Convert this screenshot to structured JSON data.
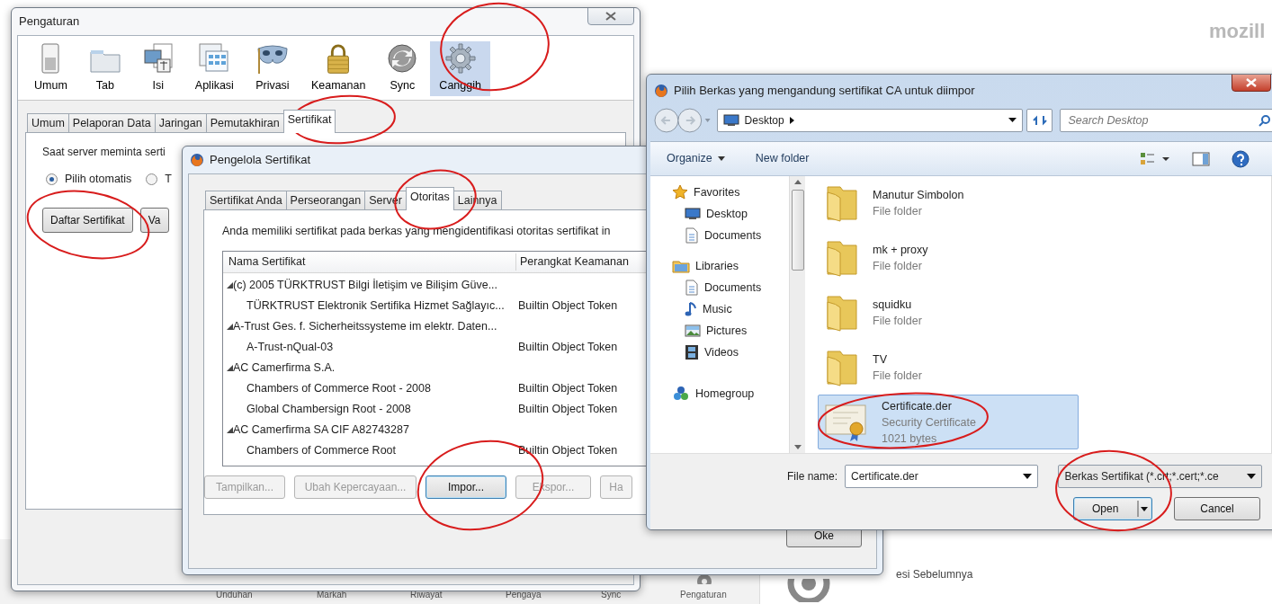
{
  "background": {
    "logo": "mozill",
    "toolbar": [
      "Unduhan",
      "Markah",
      "Riwayat",
      "Pengaya",
      "Sync",
      "Pengaturan"
    ],
    "restore": "esi Sebelumnya"
  },
  "settings_window": {
    "title": "Pengaturan",
    "categories": [
      {
        "label": "Umum",
        "selected": false
      },
      {
        "label": "Tab",
        "selected": false
      },
      {
        "label": "Isi",
        "selected": false
      },
      {
        "label": "Aplikasi",
        "selected": false
      },
      {
        "label": "Privasi",
        "selected": false
      },
      {
        "label": "Keamanan",
        "selected": false
      },
      {
        "label": "Sync",
        "selected": false
      },
      {
        "label": "Canggih",
        "selected": true
      }
    ],
    "subtabs": [
      {
        "label": "Umum",
        "selected": false
      },
      {
        "label": "Pelaporan Data",
        "selected": false
      },
      {
        "label": "Jaringan",
        "selected": false
      },
      {
        "label": "Pemutakhiran",
        "selected": false
      },
      {
        "label": "Sertifikat",
        "selected": true
      }
    ],
    "prompt": "Saat server meminta serti",
    "radios": [
      {
        "label": "Pilih otomatis",
        "selected": true
      },
      {
        "label": "T",
        "selected": false
      }
    ],
    "buttons": [
      "Daftar Sertifikat",
      "Va"
    ]
  },
  "cert_manager": {
    "title": "Pengelola Sertifikat",
    "tabs": [
      {
        "label": "Sertifikat Anda",
        "selected": false
      },
      {
        "label": "Perseorangan",
        "selected": false
      },
      {
        "label": "Server",
        "selected": false
      },
      {
        "label": "Otoritas",
        "selected": true
      },
      {
        "label": "Lainnya",
        "selected": false
      }
    ],
    "description": "Anda memiliki sertifikat pada berkas yang mengidentifikasi otoritas sertifikat in",
    "columns": [
      "Nama Sertifikat",
      "Perangkat Keamanan"
    ],
    "tree": [
      {
        "name": "(c) 2005 TÜRKTRUST Bilgi İletişim ve Bilişim Güve...",
        "expanded": true,
        "children": [
          {
            "name": "TÜRKTRUST Elektronik Sertifika Hizmet Sağlayıc...",
            "device": "Builtin Object Token"
          }
        ]
      },
      {
        "name": "A-Trust Ges. f. Sicherheitssysteme im elektr. Daten...",
        "expanded": true,
        "children": [
          {
            "name": "A-Trust-nQual-03",
            "device": "Builtin Object Token"
          }
        ]
      },
      {
        "name": "AC Camerfirma S.A.",
        "expanded": true,
        "children": [
          {
            "name": "Chambers of Commerce Root - 2008",
            "device": "Builtin Object Token"
          },
          {
            "name": "Global Chambersign Root - 2008",
            "device": "Builtin Object Token"
          }
        ]
      },
      {
        "name": "AC Camerfirma SA CIF A82743287",
        "expanded": true,
        "children": [
          {
            "name": "Chambers of Commerce Root",
            "device": "Builtin Object Token"
          }
        ]
      }
    ],
    "buttons": [
      {
        "label": "Tampilkan...",
        "disabled": true
      },
      {
        "label": "Ubah Kepercayaan...",
        "disabled": true
      },
      {
        "label": "Impor...",
        "disabled": false
      },
      {
        "label": "Ekspor...",
        "disabled": true
      },
      {
        "label": "Ha",
        "disabled": true
      }
    ],
    "ok": "Oke"
  },
  "file_dialog": {
    "title": "Pilih Berkas yang mengandung sertifikat CA untuk diimpor",
    "location": "Desktop",
    "search_placeholder": "Search Desktop",
    "toolbar": [
      "Organize",
      "New folder"
    ],
    "nav": [
      {
        "label": "Favorites",
        "kind": "group"
      },
      {
        "label": "Desktop",
        "kind": "item"
      },
      {
        "label": "Documents",
        "kind": "item"
      },
      {
        "label": "Libraries",
        "kind": "group"
      },
      {
        "label": "Documents",
        "kind": "item"
      },
      {
        "label": "Music",
        "kind": "item"
      },
      {
        "label": "Pictures",
        "kind": "item"
      },
      {
        "label": "Videos",
        "kind": "item"
      },
      {
        "label": "Homegroup",
        "kind": "group"
      }
    ],
    "files": [
      {
        "name": "Manutur Simbolon",
        "type": "File folder",
        "kind": "folder",
        "selected": false
      },
      {
        "name": "mk + proxy",
        "type": "File folder",
        "kind": "folder",
        "selected": false
      },
      {
        "name": "squidku",
        "type": "File folder",
        "kind": "folder",
        "selected": false
      },
      {
        "name": "TV",
        "type": "File folder",
        "kind": "folder",
        "selected": false
      },
      {
        "name": "Certificate.der",
        "type": "Security Certificate",
        "size": "1021 bytes",
        "kind": "certificate",
        "selected": true
      }
    ],
    "file_name_label": "File name:",
    "file_name": "Certificate.der",
    "filter": "Berkas Sertifikat (*.crt;*.cert;*.ce",
    "open": "Open",
    "cancel": "Cancel"
  }
}
